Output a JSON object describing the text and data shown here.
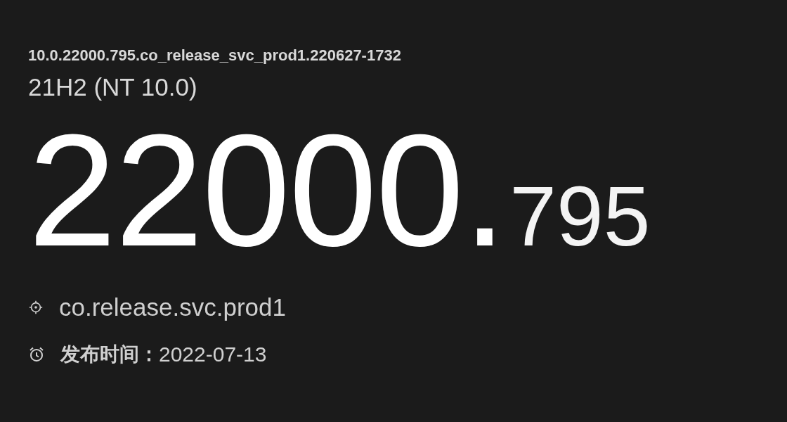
{
  "full_build": "10.0.22000.795.co_release_svc_prod1.220627-1732",
  "version": "21H2 (NT 10.0)",
  "build": {
    "major": "22000.",
    "minor": "795"
  },
  "branch": {
    "value": "co.release.svc.prod1"
  },
  "release_date": {
    "label": "发布时间：",
    "value": "2022-07-13"
  }
}
